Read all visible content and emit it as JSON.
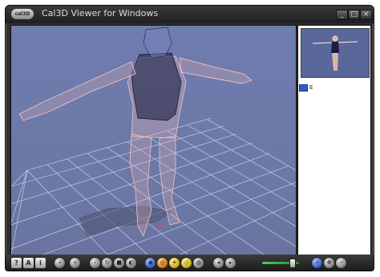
{
  "window": {
    "title": "Cal3D Viewer for Windows",
    "icon_label": "cal3D"
  },
  "window_controls": {
    "minimize": "_",
    "maximize": "□",
    "close": "×"
  },
  "side_panel": {
    "tree_item_label": "E"
  },
  "toolbar": {
    "text_buttons": [
      "?",
      "A",
      "i"
    ],
    "speed_slider_value": 0.8
  },
  "colors": {
    "viewport_bg": "#6d79aa",
    "grid": "#c9cfe6",
    "skin_wire": "#f0b9b9",
    "suit_wire": "#151a3a",
    "window_frame": "#2e2e2e"
  }
}
